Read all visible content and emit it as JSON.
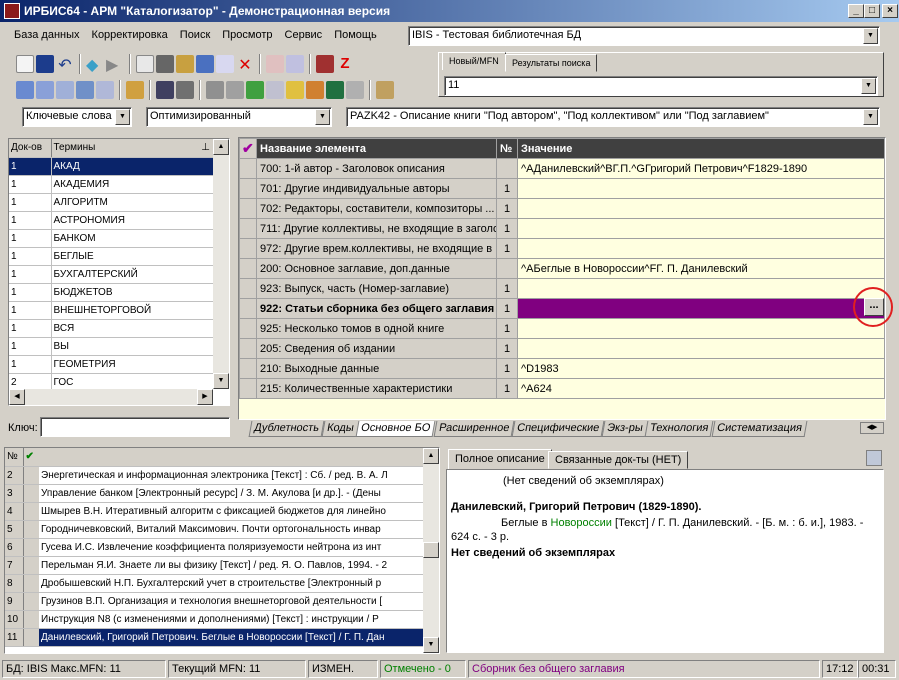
{
  "window": {
    "title": "ИРБИС64 - АРМ \"Каталогизатор\" - Демонстрационная версия",
    "min": "_",
    "max": "□",
    "close": "×"
  },
  "menu": [
    "База данных",
    "Корректировка",
    "Поиск",
    "Просмотр",
    "Сервис",
    "Помощь"
  ],
  "db_combo": "IBIS - Тестовая библиотечная БД",
  "tabs_top": [
    "Новый/MFN",
    "Результаты поиска"
  ],
  "mfn_combo": "11",
  "search": {
    "mode": "Ключевые слова",
    "optim": "Оптимизированный",
    "worksheet": "PAZK42 - Описание книги \"Под автором\", \"Под коллективом\" или \"Под заглавием\""
  },
  "terms": {
    "col_count": "Док-ов",
    "col_term": "Термины",
    "pin": "⊥",
    "rows": [
      [
        "1",
        "АКАД"
      ],
      [
        "1",
        "АКАДЕМИЯ"
      ],
      [
        "1",
        "АЛГОРИТМ"
      ],
      [
        "1",
        "АСТРОНОМИЯ"
      ],
      [
        "1",
        "БАНКОМ"
      ],
      [
        "1",
        "БЕГЛЫЕ"
      ],
      [
        "1",
        "БУХГАЛТЕРСКИЙ"
      ],
      [
        "1",
        "БЮДЖЕТОВ"
      ],
      [
        "1",
        "ВНЕШНЕТОРГОВОЙ"
      ],
      [
        "1",
        "ВСЯ"
      ],
      [
        "1",
        "ВЫ"
      ],
      [
        "1",
        "ГЕОМЕТРИЯ"
      ],
      [
        "2",
        "ГОС"
      ]
    ],
    "key_label": "Ключ:"
  },
  "grid": {
    "col_name": "Название элемента",
    "col_num": "№",
    "col_value": "Значение",
    "rows": [
      {
        "name": "700: 1-й автор - Заголовок описания",
        "num": "",
        "value": "^AДанилевский^BГ.П.^GГригорий Петрович^F1829-1890"
      },
      {
        "name": "701: Другие индивидуальные авторы",
        "num": "1",
        "value": ""
      },
      {
        "name": "702: Редакторы, составители, композиторы ...",
        "num": "1",
        "value": ""
      },
      {
        "name": "711: Другие коллективы, не входящие в заголо",
        "num": "1",
        "value": ""
      },
      {
        "name": "972: Другие врем.коллективы, не входящие в",
        "num": "1",
        "value": ""
      },
      {
        "name": "200: Основное заглавие, доп.данные",
        "num": "",
        "value": "^AБеглые в Новороссии^FГ. П. Данилевский"
      },
      {
        "name": "923: Выпуск, часть (Номер-заглавие)",
        "num": "1",
        "value": ""
      },
      {
        "name": "922: Статьи сборника без общего заглавия",
        "num": "1",
        "value": ""
      },
      {
        "name": "925: Несколько томов в одной книге",
        "num": "1",
        "value": ""
      },
      {
        "name": "205: Сведения об издании",
        "num": "1",
        "value": ""
      },
      {
        "name": "210: Выходные данные",
        "num": "1",
        "value": "^D1983"
      },
      {
        "name": "215: Количественные характеристики",
        "num": "1",
        "value": "^A624"
      }
    ],
    "ellipsis": "..."
  },
  "bottom_tabs": [
    "Дублетность",
    "Коды",
    "Основное БО",
    "Расширенное",
    "Специфические",
    "Экз-ры",
    "Технология",
    "Систематизация"
  ],
  "results": {
    "col_num": "№",
    "rows": [
      [
        "2",
        "Энергетическая и информационная электроника [Текст] : Сб. / ред. В. А. Л"
      ],
      [
        "3",
        "Управление банком [Электронный ресурс]  / З. М. Акулова [и др.]. - (Дены"
      ],
      [
        "4",
        "Шмырев В.Н. Итеративный алгоритм с фиксацией бюджетов для линейно"
      ],
      [
        "5",
        "Городничевковский, Виталий Максимович. Почти ортогональность инвар"
      ],
      [
        "6",
        "Гусева И.С. Извлечение коэффициента поляризуемости нейтрона из инт"
      ],
      [
        "7",
        "Перельман Я.И. Знаете ли вы физику [Текст] / ред. Я. О. Павлов, 1994. - 2"
      ],
      [
        "8",
        "Дробышевский Н.П. Бухгалтерский учет в строительстве [Электронный р"
      ],
      [
        "9",
        "Грузинов В.П. Организация и технология внешнеторговой деятельности ["
      ],
      [
        "10",
        "Инструкция N8   (с изменениями и дополнениями) [Текст] : инструкции / Р"
      ],
      [
        "11",
        "Данилевский, Григорий Петрович. Беглые в Новороссии [Текст] / Г. П. Дан"
      ]
    ]
  },
  "desc_tabs": [
    "Полное описание",
    "Связанные док-ты (НЕТ)"
  ],
  "description": {
    "line1": "(Нет сведений об экземплярах)",
    "author": "Данилевский, Григорий Петрович (1829-1890).",
    "body_a": "Беглые в ",
    "body_link": "Новороссии",
    "body_b": " [Текст] / Г. П. Данилевский. - [Б. м. : б. и.], 1983. - 624 с. - 3 р.",
    "copies": "Нет сведений об экземплярах"
  },
  "status": {
    "db": "БД: IBIS Макс.MFN: 11",
    "cur": "Текущий MFN: 11",
    "changed": "ИЗМЕН.",
    "marked": "Отмечено - 0",
    "ws": "Сборник без общего заглавия",
    "time": "17:12",
    "elapsed": "00:31"
  },
  "colors": {
    "selection": "#0a246a",
    "purple": "#800080",
    "green": "#008000",
    "value_bg": "#ffffe0"
  }
}
